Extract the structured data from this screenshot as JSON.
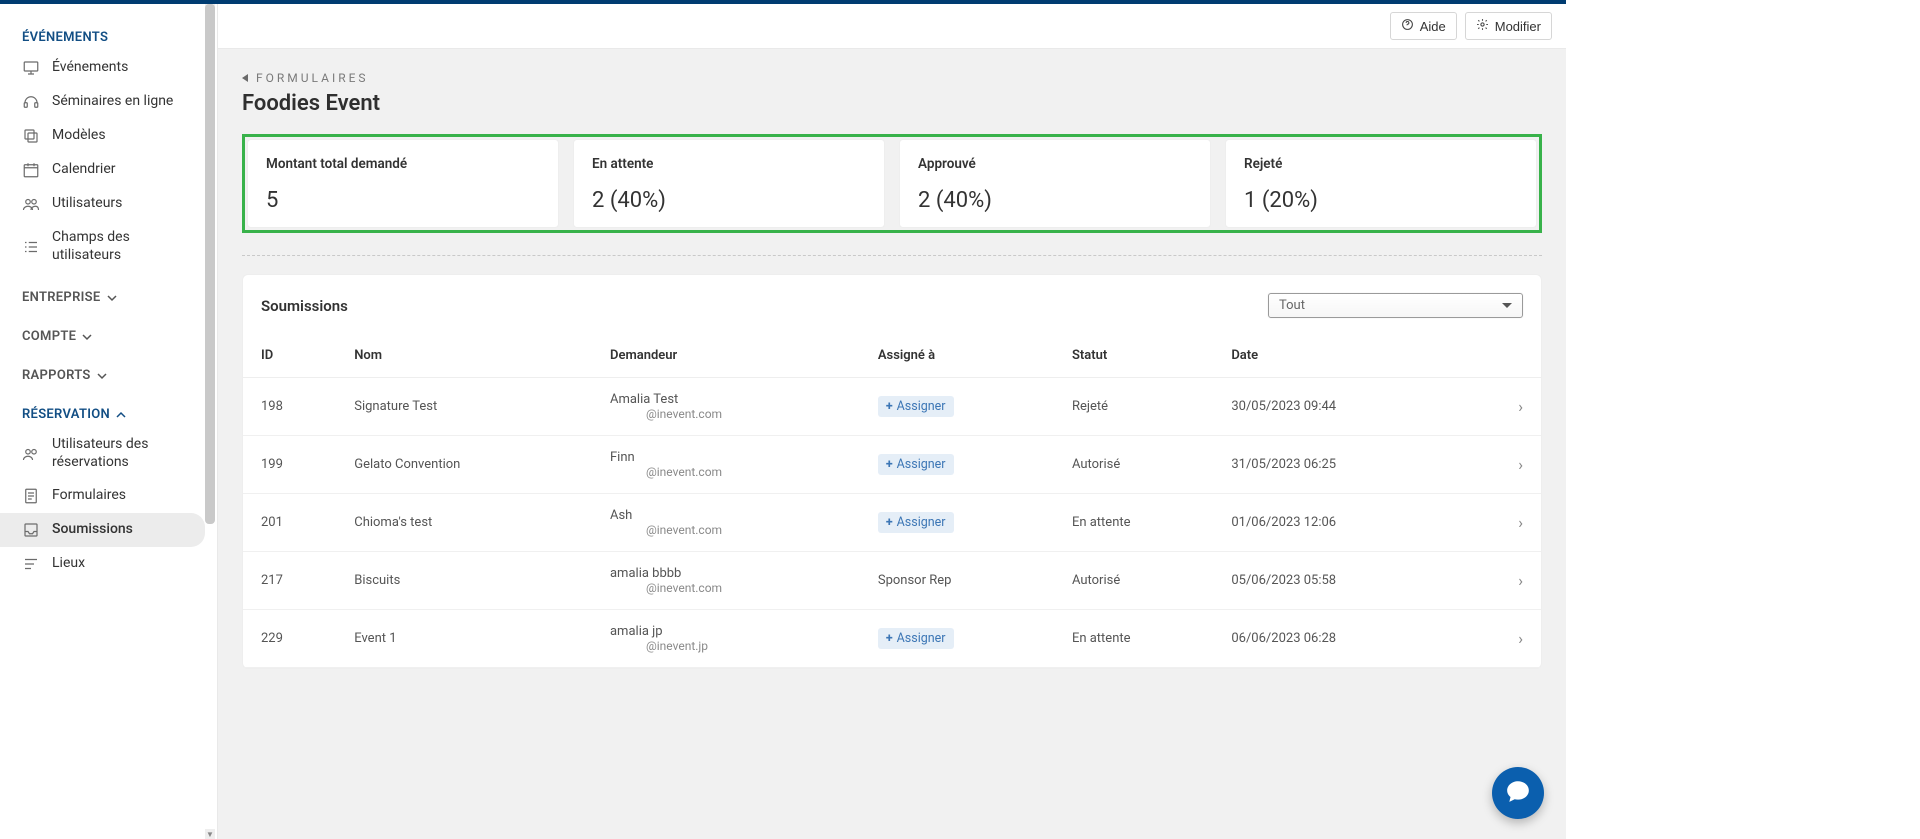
{
  "header": {
    "help_label": "Aide",
    "modify_label": "Modifier"
  },
  "sidebar": {
    "section_events_title": "ÉVÉNEMENTS",
    "events_items": [
      {
        "label": "Événements"
      },
      {
        "label": "Séminaires en ligne"
      },
      {
        "label": "Modèles"
      },
      {
        "label": "Calendrier"
      },
      {
        "label": "Utilisateurs"
      },
      {
        "label": "Champs des utilisateurs"
      }
    ],
    "section_company_title": "ENTREPRISE",
    "section_account_title": "COMPTE",
    "section_reports_title": "RAPPORTS",
    "section_booking_title": "RÉSERVATION",
    "booking_items": [
      {
        "label": "Utilisateurs des réservations"
      },
      {
        "label": "Formulaires"
      },
      {
        "label": "Soumissions"
      },
      {
        "label": "Lieux"
      }
    ]
  },
  "breadcrumb": {
    "label": "FORMULAIRES"
  },
  "page": {
    "title": "Foodies Event"
  },
  "stats": [
    {
      "label": "Montant total demandé",
      "value": "5"
    },
    {
      "label": "En attente",
      "value": "2 (40%)"
    },
    {
      "label": "Approuvé",
      "value": "2 (40%)"
    },
    {
      "label": "Rejeté",
      "value": "1 (20%)"
    }
  ],
  "panel": {
    "title": "Soumissions",
    "filter_label": "Tout"
  },
  "table": {
    "columns": [
      "ID",
      "Nom",
      "Demandeur",
      "Assigné à",
      "Statut",
      "Date",
      ""
    ],
    "assign_label": "Assigner",
    "rows": [
      {
        "id": "198",
        "name": "Signature Test",
        "requester_name": "Amalia Test",
        "requester_email": "@inevent.com",
        "assigned": null,
        "status": "Rejeté",
        "date": "30/05/2023 09:44"
      },
      {
        "id": "199",
        "name": "Gelato Convention",
        "requester_name": "Finn",
        "requester_email": "@inevent.com",
        "assigned": null,
        "status": "Autorisé",
        "date": "31/05/2023 06:25"
      },
      {
        "id": "201",
        "name": "Chioma's test",
        "requester_name": "Ash",
        "requester_email": "@inevent.com",
        "assigned": null,
        "status": "En attente",
        "date": "01/06/2023 12:06"
      },
      {
        "id": "217",
        "name": "Biscuits",
        "requester_name": "amalia bbbb",
        "requester_email": "@inevent.com",
        "assigned": "Sponsor Rep",
        "status": "Autorisé",
        "date": "05/06/2023 05:58"
      },
      {
        "id": "229",
        "name": "Event 1",
        "requester_name": "amalia jp",
        "requester_email": "@inevent.jp",
        "assigned": null,
        "status": "En attente",
        "date": "06/06/2023 06:28"
      }
    ]
  }
}
